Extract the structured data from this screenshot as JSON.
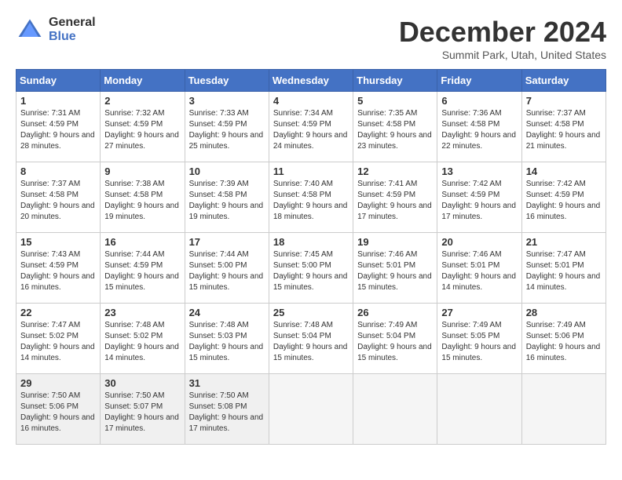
{
  "logo": {
    "general": "General",
    "blue": "Blue"
  },
  "title": "December 2024",
  "subtitle": "Summit Park, Utah, United States",
  "days_header": [
    "Sunday",
    "Monday",
    "Tuesday",
    "Wednesday",
    "Thursday",
    "Friday",
    "Saturday"
  ],
  "weeks": [
    [
      {
        "day": "1",
        "sunrise": "7:31 AM",
        "sunset": "4:59 PM",
        "daylight": "9 hours and 28 minutes."
      },
      {
        "day": "2",
        "sunrise": "7:32 AM",
        "sunset": "4:59 PM",
        "daylight": "9 hours and 27 minutes."
      },
      {
        "day": "3",
        "sunrise": "7:33 AM",
        "sunset": "4:59 PM",
        "daylight": "9 hours and 25 minutes."
      },
      {
        "day": "4",
        "sunrise": "7:34 AM",
        "sunset": "4:59 PM",
        "daylight": "9 hours and 24 minutes."
      },
      {
        "day": "5",
        "sunrise": "7:35 AM",
        "sunset": "4:58 PM",
        "daylight": "9 hours and 23 minutes."
      },
      {
        "day": "6",
        "sunrise": "7:36 AM",
        "sunset": "4:58 PM",
        "daylight": "9 hours and 22 minutes."
      },
      {
        "day": "7",
        "sunrise": "7:37 AM",
        "sunset": "4:58 PM",
        "daylight": "9 hours and 21 minutes."
      }
    ],
    [
      {
        "day": "8",
        "sunrise": "7:37 AM",
        "sunset": "4:58 PM",
        "daylight": "9 hours and 20 minutes."
      },
      {
        "day": "9",
        "sunrise": "7:38 AM",
        "sunset": "4:58 PM",
        "daylight": "9 hours and 19 minutes."
      },
      {
        "day": "10",
        "sunrise": "7:39 AM",
        "sunset": "4:58 PM",
        "daylight": "9 hours and 19 minutes."
      },
      {
        "day": "11",
        "sunrise": "7:40 AM",
        "sunset": "4:58 PM",
        "daylight": "9 hours and 18 minutes."
      },
      {
        "day": "12",
        "sunrise": "7:41 AM",
        "sunset": "4:59 PM",
        "daylight": "9 hours and 17 minutes."
      },
      {
        "day": "13",
        "sunrise": "7:42 AM",
        "sunset": "4:59 PM",
        "daylight": "9 hours and 17 minutes."
      },
      {
        "day": "14",
        "sunrise": "7:42 AM",
        "sunset": "4:59 PM",
        "daylight": "9 hours and 16 minutes."
      }
    ],
    [
      {
        "day": "15",
        "sunrise": "7:43 AM",
        "sunset": "4:59 PM",
        "daylight": "9 hours and 16 minutes."
      },
      {
        "day": "16",
        "sunrise": "7:44 AM",
        "sunset": "4:59 PM",
        "daylight": "9 hours and 15 minutes."
      },
      {
        "day": "17",
        "sunrise": "7:44 AM",
        "sunset": "5:00 PM",
        "daylight": "9 hours and 15 minutes."
      },
      {
        "day": "18",
        "sunrise": "7:45 AM",
        "sunset": "5:00 PM",
        "daylight": "9 hours and 15 minutes."
      },
      {
        "day": "19",
        "sunrise": "7:46 AM",
        "sunset": "5:01 PM",
        "daylight": "9 hours and 15 minutes."
      },
      {
        "day": "20",
        "sunrise": "7:46 AM",
        "sunset": "5:01 PM",
        "daylight": "9 hours and 14 minutes."
      },
      {
        "day": "21",
        "sunrise": "7:47 AM",
        "sunset": "5:01 PM",
        "daylight": "9 hours and 14 minutes."
      }
    ],
    [
      {
        "day": "22",
        "sunrise": "7:47 AM",
        "sunset": "5:02 PM",
        "daylight": "9 hours and 14 minutes."
      },
      {
        "day": "23",
        "sunrise": "7:48 AM",
        "sunset": "5:02 PM",
        "daylight": "9 hours and 14 minutes."
      },
      {
        "day": "24",
        "sunrise": "7:48 AM",
        "sunset": "5:03 PM",
        "daylight": "9 hours and 15 minutes."
      },
      {
        "day": "25",
        "sunrise": "7:48 AM",
        "sunset": "5:04 PM",
        "daylight": "9 hours and 15 minutes."
      },
      {
        "day": "26",
        "sunrise": "7:49 AM",
        "sunset": "5:04 PM",
        "daylight": "9 hours and 15 minutes."
      },
      {
        "day": "27",
        "sunrise": "7:49 AM",
        "sunset": "5:05 PM",
        "daylight": "9 hours and 15 minutes."
      },
      {
        "day": "28",
        "sunrise": "7:49 AM",
        "sunset": "5:06 PM",
        "daylight": "9 hours and 16 minutes."
      }
    ],
    [
      {
        "day": "29",
        "sunrise": "7:50 AM",
        "sunset": "5:06 PM",
        "daylight": "9 hours and 16 minutes."
      },
      {
        "day": "30",
        "sunrise": "7:50 AM",
        "sunset": "5:07 PM",
        "daylight": "9 hours and 17 minutes."
      },
      {
        "day": "31",
        "sunrise": "7:50 AM",
        "sunset": "5:08 PM",
        "daylight": "9 hours and 17 minutes."
      },
      null,
      null,
      null,
      null
    ]
  ]
}
